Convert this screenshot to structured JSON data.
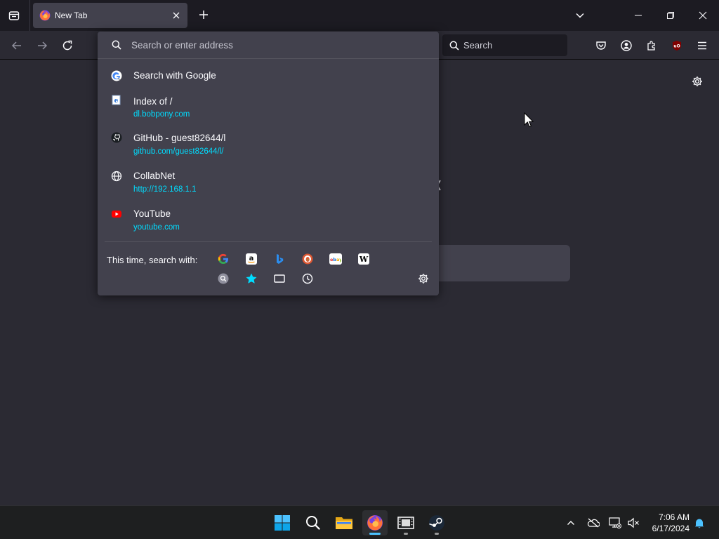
{
  "browser": {
    "tab": {
      "title": "New Tab"
    },
    "search_bar": {
      "label": "Search"
    }
  },
  "urlbar": {
    "placeholder": "Search or enter address",
    "results": [
      {
        "icon": "google-g-icon",
        "title": "Search with Google",
        "url": ""
      },
      {
        "icon": "ie-page-icon",
        "title": "Index of /",
        "url": "dl.bobpony.com"
      },
      {
        "icon": "github-icon",
        "title": "GitHub - guest82644/l",
        "url": "github.com/guest82644/l/"
      },
      {
        "icon": "globe-icon",
        "title": "CollabNet",
        "url": "http://192.168.1.1"
      },
      {
        "icon": "youtube-icon",
        "title": "YouTube",
        "url": "youtube.com"
      }
    ],
    "one_off_label": "This time, search with:",
    "one_off_engines": [
      "google-icon",
      "amazon-icon",
      "bing-icon",
      "duckduckgo-icon",
      "ebay-icon",
      "wikipedia-icon"
    ],
    "one_off_local": [
      "search-engines-icon",
      "bookmarks-star-icon",
      "tabs-icon",
      "history-clock-icon"
    ]
  },
  "taskbar": {
    "clock_time": "7:06 AM",
    "clock_date": "6/17/2024"
  },
  "colors": {
    "accent_link": "#00ddff",
    "active_indicator": "#4cc2ff",
    "dropdown_bg": "#42414d",
    "page_bg": "#2b2a33"
  }
}
